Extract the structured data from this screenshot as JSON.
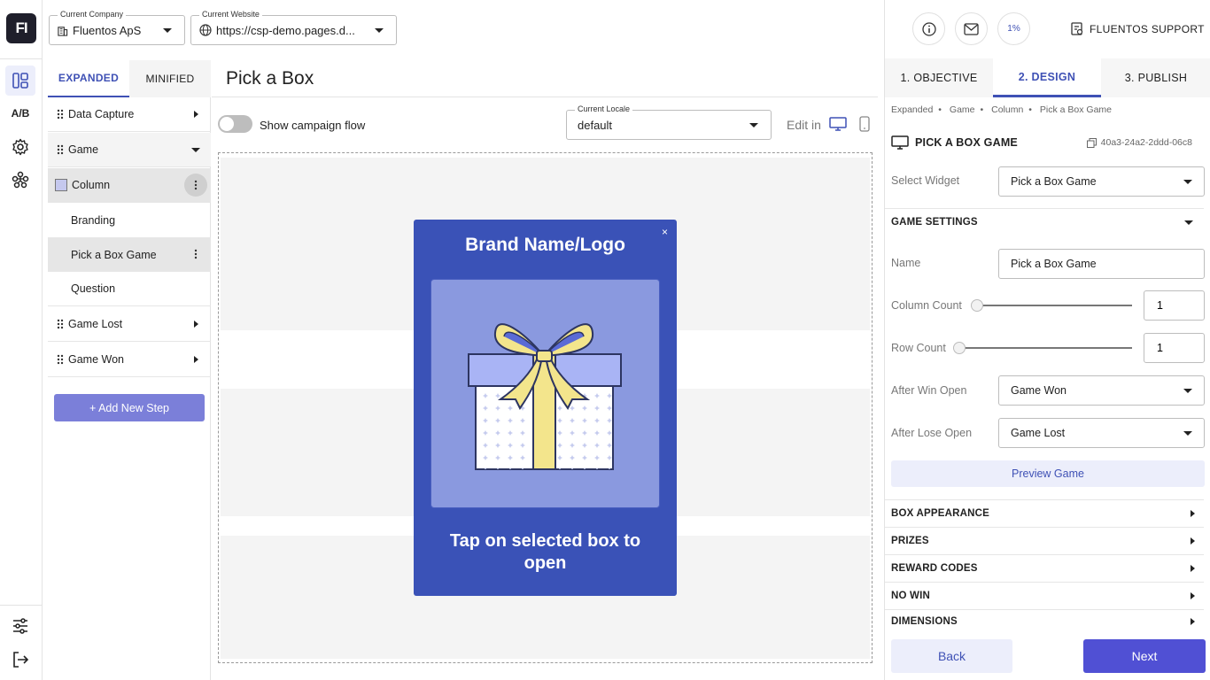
{
  "app": {
    "logo_text": "FI",
    "ab_label": "A/B"
  },
  "header": {
    "company_legend": "Current Company",
    "company_value": "Fluentos ApS",
    "website_legend": "Current Website",
    "website_value": "https://csp-demo.pages.d..."
  },
  "steps_panel": {
    "tabs": [
      {
        "label": "EXPANDED"
      },
      {
        "label": "MINIFIED"
      }
    ],
    "items": [
      {
        "label": "Data Capture"
      },
      {
        "label": "Game"
      },
      {
        "label": "Column"
      },
      {
        "label": "Branding"
      },
      {
        "label": "Pick a Box Game"
      },
      {
        "label": "Question"
      },
      {
        "label": "Game Lost"
      },
      {
        "label": "Game Won"
      }
    ],
    "add_step_label": "+ Add New Step"
  },
  "main": {
    "title": "Pick a Box",
    "flow_toggle_label": "Show campaign flow",
    "locale_legend": "Current Locale",
    "locale_value": "default",
    "edit_in_label": "Edit in"
  },
  "popup": {
    "brand_title": "Brand Name/Logo",
    "close_symbol": "×",
    "cta_text": "Tap on selected box to open"
  },
  "right_panel": {
    "progress_text": "1%",
    "support_label": "FLUENTOS SUPPORT",
    "tabs": [
      {
        "label": "1. OBJECTIVE"
      },
      {
        "label": "2. DESIGN"
      },
      {
        "label": "3. PUBLISH"
      }
    ],
    "breadcrumb": [
      "Expanded",
      "Game",
      "Column",
      "Pick a Box Game"
    ],
    "widget_title": "PICK A BOX GAME",
    "widget_id": "40a3-24a2-2ddd-06c8",
    "select_widget_label": "Select Widget",
    "select_widget_value": "Pick a Box Game",
    "game_settings_label": "GAME SETTINGS",
    "name_label": "Name",
    "name_value": "Pick a Box Game",
    "column_count_label": "Column Count",
    "column_count_value": "1",
    "row_count_label": "Row Count",
    "row_count_value": "1",
    "after_win_label": "After Win Open",
    "after_win_value": "Game Won",
    "after_lose_label": "After Lose Open",
    "after_lose_value": "Game Lost",
    "preview_label": "Preview Game",
    "sections": [
      {
        "label": "BOX APPEARANCE"
      },
      {
        "label": "PRIZES"
      },
      {
        "label": "REWARD CODES"
      },
      {
        "label": "NO WIN"
      },
      {
        "label": "DIMENSIONS"
      }
    ],
    "back_label": "Back",
    "next_label": "Next"
  },
  "colors": {
    "accent": "#3f51b5",
    "popup_bg": "#3a52b7",
    "box_card": "#8a99df",
    "next_button": "#5050d4",
    "add_step_button": "#7b7fd9"
  }
}
